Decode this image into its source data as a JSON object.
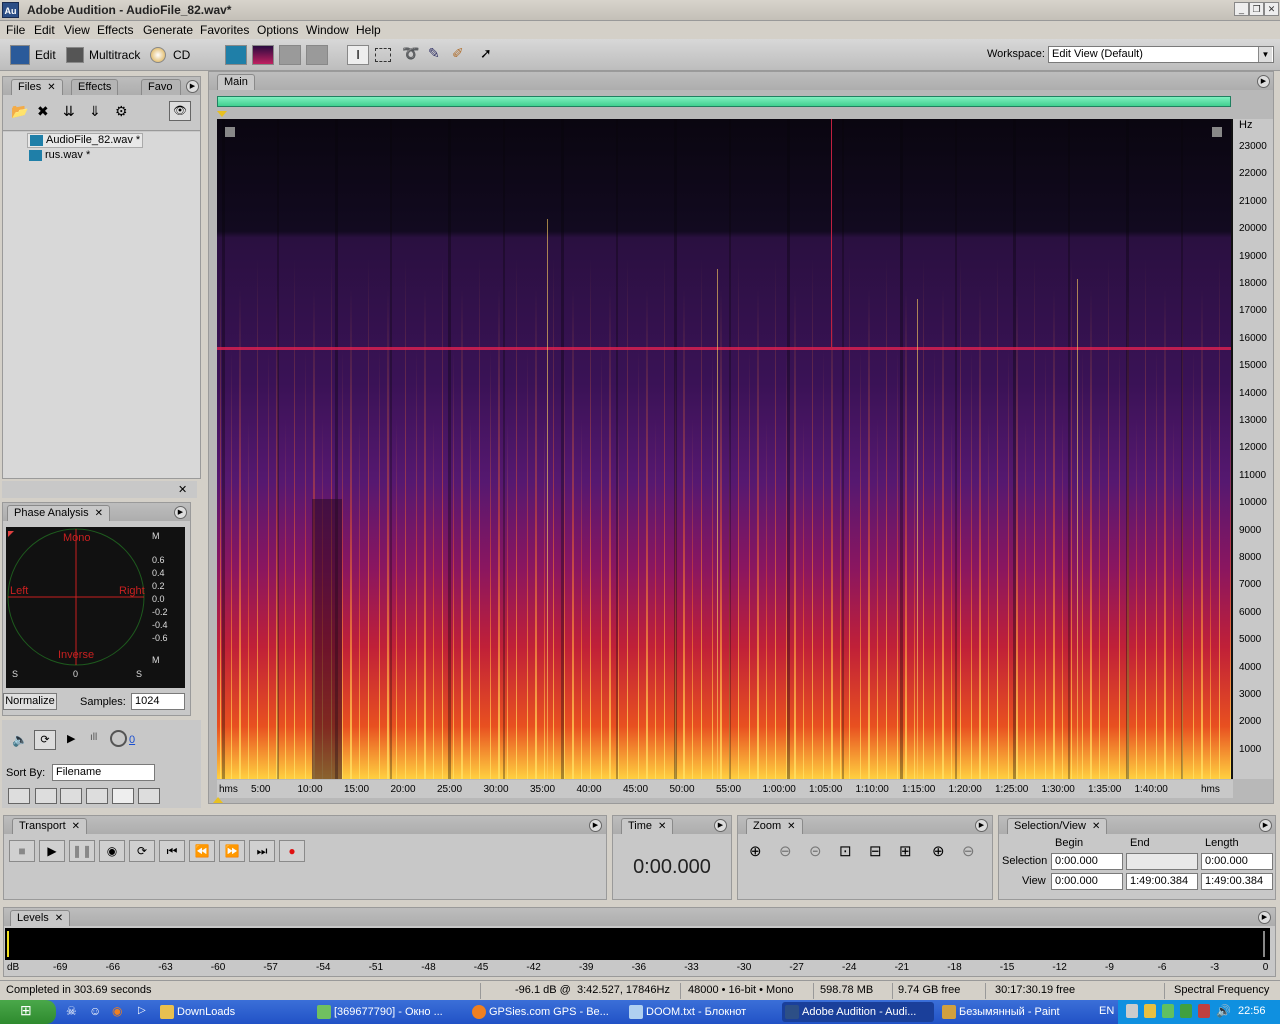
{
  "window": {
    "app_icon": "Au",
    "title": "Adobe Audition - AudioFile_82.wav*"
  },
  "menu": [
    "File",
    "Edit",
    "View",
    "Effects",
    "Generate",
    "Favorites",
    "Options",
    "Window",
    "Help"
  ],
  "toolbar": {
    "edit_label": "Edit",
    "multitrack_label": "Multitrack",
    "cd_label": "CD",
    "workspace_label": "Workspace:",
    "workspace_value": "Edit View (Default)"
  },
  "files_panel": {
    "tabs": [
      "Files",
      "Effects",
      "Favo"
    ],
    "files": [
      "AudioFile_82.wav *",
      "rus.wav *"
    ],
    "sort_label": "Sort By:",
    "sort_value": "Filename"
  },
  "phase_panel": {
    "tab": "Phase Analysis",
    "labels": {
      "mono": "Mono",
      "left": "Left",
      "right": "Right",
      "inverse": "Inverse"
    },
    "scale": [
      "M",
      "0.6",
      "0.4",
      "0.2",
      "0.0",
      "-0.2",
      "-0.4",
      "-0.6",
      "M"
    ],
    "bottom": [
      "S",
      "0",
      "S"
    ],
    "normalize_label": "Normalize",
    "samples_label": "Samples:",
    "samples_value": "1024",
    "loop_value": "0"
  },
  "main_panel": {
    "tab": "Main",
    "freq_unit": "Hz",
    "freq_ticks": [
      "23000",
      "22000",
      "21000",
      "20000",
      "19000",
      "18000",
      "17000",
      "16000",
      "15000",
      "14000",
      "13000",
      "12000",
      "11000",
      "10000",
      "9000",
      "8000",
      "7000",
      "6000",
      "5000",
      "4000",
      "3000",
      "2000",
      "1000"
    ],
    "time_ticks": [
      "hms",
      "5:00",
      "10:00",
      "15:00",
      "20:00",
      "25:00",
      "30:00",
      "35:00",
      "40:00",
      "45:00",
      "50:00",
      "55:00",
      "1:00:00",
      "1:05:00",
      "1:10:00",
      "1:15:00",
      "1:20:00",
      "1:25:00",
      "1:30:00",
      "1:35:00",
      "1:40:00",
      "hms"
    ]
  },
  "transport": {
    "tab": "Transport"
  },
  "time_panel": {
    "tab": "Time",
    "value": "0:00.000"
  },
  "zoom_panel": {
    "tab": "Zoom"
  },
  "selection_panel": {
    "tab": "Selection/View",
    "headers": [
      "Begin",
      "End",
      "Length"
    ],
    "rows": [
      {
        "label": "Selection",
        "begin": "0:00.000",
        "end": "",
        "length": "0:00.000"
      },
      {
        "label": "View",
        "begin": "0:00.000",
        "end": "1:49:00.384",
        "length": "1:49:00.384"
      }
    ]
  },
  "levels_panel": {
    "tab": "Levels",
    "ticks": [
      "dB",
      "-69",
      "-66",
      "-63",
      "-60",
      "-57",
      "-54",
      "-51",
      "-48",
      "-45",
      "-42",
      "-39",
      "-36",
      "-33",
      "-30",
      "-27",
      "-24",
      "-21",
      "-18",
      "-15",
      "-12",
      "-9",
      "-6",
      "-3",
      "0"
    ]
  },
  "status": {
    "completed": "Completed in 303.69 seconds",
    "cursor": "-96.1 dB @",
    "position": "3:42.527, 17846Hz",
    "format": "48000 • 16-bit • Mono",
    "size": "598.78 MB",
    "free": "9.74 GB free",
    "time_free": "30:17:30.19 free",
    "view": "Spectral Frequency"
  },
  "taskbar": {
    "items": [
      "DownLoads",
      "[369677790] - Окно ...",
      "GPSies.com GPS - Be...",
      "DOOM.txt - Блокнот",
      "Adobe Audition - Audi...",
      "Безымянный - Paint"
    ],
    "lang": "EN",
    "clock": "22:56"
  },
  "colors": {
    "progress": "#40e0a0",
    "spectral_dark": "#0a0610",
    "spectral_hot": "#ffd040"
  }
}
